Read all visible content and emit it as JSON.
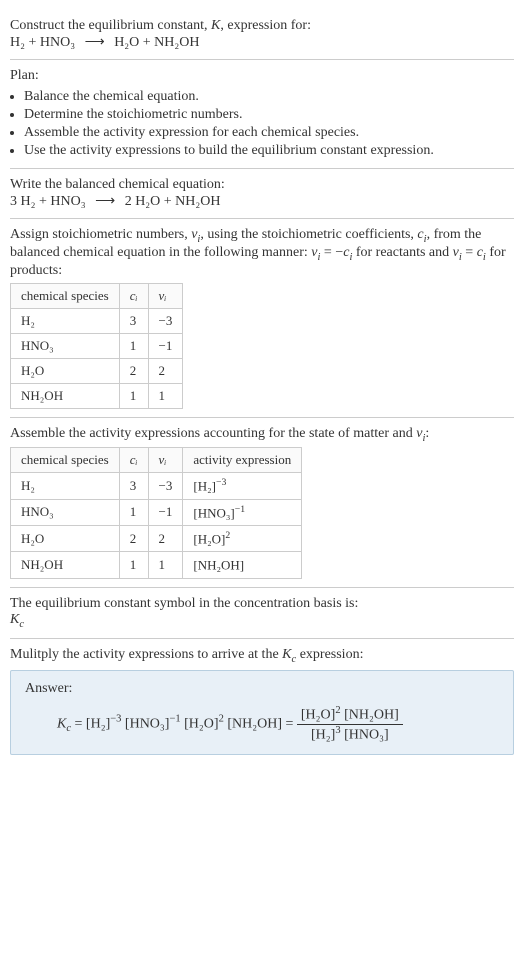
{
  "s1": {
    "prompt_a": "Construct the equilibrium constant, ",
    "prompt_b": ", expression for:",
    "K": "K",
    "eq_lhs": "H₂ + HNO₃",
    "arrow": "⟶",
    "eq_rhs": "H₂O + NH₂OH"
  },
  "s2": {
    "title": "Plan:",
    "items": [
      "Balance the chemical equation.",
      "Determine the stoichiometric numbers.",
      "Assemble the activity expression for each chemical species.",
      "Use the activity expressions to build the equilibrium constant expression."
    ]
  },
  "s3": {
    "title": "Write the balanced chemical equation:",
    "eq_lhs": "3 H₂ + HNO₃",
    "arrow": "⟶",
    "eq_rhs": "2 H₂O + NH₂OH"
  },
  "s4": {
    "text_a": "Assign stoichiometric numbers, ",
    "nu": "ν",
    "sub_i": "i",
    "text_b": ", using the stoichiometric coefficients, ",
    "c": "c",
    "text_c": ", from the balanced chemical equation in the following manner: ",
    "rel1_l": "ν",
    "rel1_eq": " = −",
    "rel1_r": "c",
    "text_d": " for reactants and ",
    "rel2_eq": " = ",
    "text_e": " for products:",
    "headers": [
      "chemical species",
      "cᵢ",
      "νᵢ"
    ],
    "rows": [
      {
        "sp": "H₂",
        "c": "3",
        "v": "−3"
      },
      {
        "sp": "HNO₃",
        "c": "1",
        "v": "−1"
      },
      {
        "sp": "H₂O",
        "c": "2",
        "v": "2"
      },
      {
        "sp": "NH₂OH",
        "c": "1",
        "v": "1"
      }
    ]
  },
  "s5": {
    "text_a": "Assemble the activity expressions accounting for the state of matter and ",
    "nu": "ν",
    "sub_i": "i",
    "colon": ":",
    "headers": [
      "chemical species",
      "cᵢ",
      "νᵢ",
      "activity expression"
    ],
    "rows": [
      {
        "sp": "H₂",
        "c": "3",
        "v": "−3",
        "base": "[H₂]",
        "exp": "−3"
      },
      {
        "sp": "HNO₃",
        "c": "1",
        "v": "−1",
        "base": "[HNO₃]",
        "exp": "−1"
      },
      {
        "sp": "H₂O",
        "c": "2",
        "v": "2",
        "base": "[H₂O]",
        "exp": "2"
      },
      {
        "sp": "NH₂OH",
        "c": "1",
        "v": "1",
        "base": "[NH₂OH]",
        "exp": ""
      }
    ]
  },
  "s6": {
    "text": "The equilibrium constant symbol in the concentration basis is:",
    "sym": "K",
    "sub": "c"
  },
  "s7": {
    "text_a": "Mulitply the activity expressions to arrive at the ",
    "K": "K",
    "sub": "c",
    "text_b": " expression:",
    "answer_label": "Answer:",
    "lhs_K": "K",
    "lhs_sub": "c",
    "eq": " = ",
    "t1_b": "[H₂]",
    "t1_e": "−3",
    "t2_b": "[HNO₃]",
    "t2_e": "−1",
    "t3_b": "[H₂O]",
    "t3_e": "2",
    "t4_b": "[NH₂OH]",
    "eq2": " = ",
    "num1_b": "[H₂O]",
    "num1_e": "2",
    "num2_b": "[NH₂OH]",
    "den1_b": "[H₂]",
    "den1_e": "3",
    "den2_b": "[HNO₃]"
  },
  "chart_data": {
    "type": "table",
    "tables": [
      {
        "title": "Stoichiometric numbers",
        "headers": [
          "chemical species",
          "c_i",
          "ν_i"
        ],
        "rows": [
          [
            "H₂",
            3,
            -3
          ],
          [
            "HNO₃",
            1,
            -1
          ],
          [
            "H₂O",
            2,
            2
          ],
          [
            "NH₂OH",
            1,
            1
          ]
        ]
      },
      {
        "title": "Activity expressions",
        "headers": [
          "chemical species",
          "c_i",
          "ν_i",
          "activity expression"
        ],
        "rows": [
          [
            "H₂",
            3,
            -3,
            "[H₂]^(-3)"
          ],
          [
            "HNO₃",
            1,
            -1,
            "[HNO₃]^(-1)"
          ],
          [
            "H₂O",
            2,
            2,
            "[H₂O]^2"
          ],
          [
            "NH₂OH",
            1,
            1,
            "[NH₂OH]"
          ]
        ]
      }
    ]
  }
}
